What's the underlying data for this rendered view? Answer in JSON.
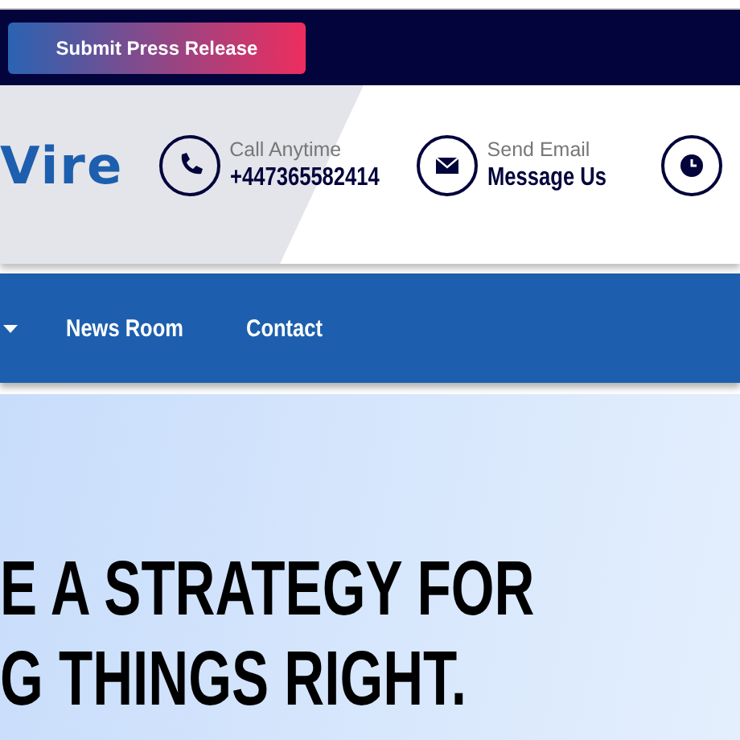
{
  "top_bar": {
    "button": "Submit Press Release"
  },
  "header": {
    "logo": "Vire",
    "contacts": [
      {
        "kind": "phone",
        "label": "Call Anytime",
        "value": "+447365582414"
      },
      {
        "kind": "email",
        "label": "Send Email",
        "value": "Message Us"
      },
      {
        "kind": "clock"
      }
    ]
  },
  "nav": {
    "items": [
      {
        "kind": "dropdown"
      },
      {
        "kind": "link",
        "label": "News Room"
      },
      {
        "kind": "link",
        "label": "Contact"
      }
    ]
  },
  "hero": {
    "lines": [
      "E A STRATEGY FOR",
      "G THINGS RIGHT."
    ]
  }
}
